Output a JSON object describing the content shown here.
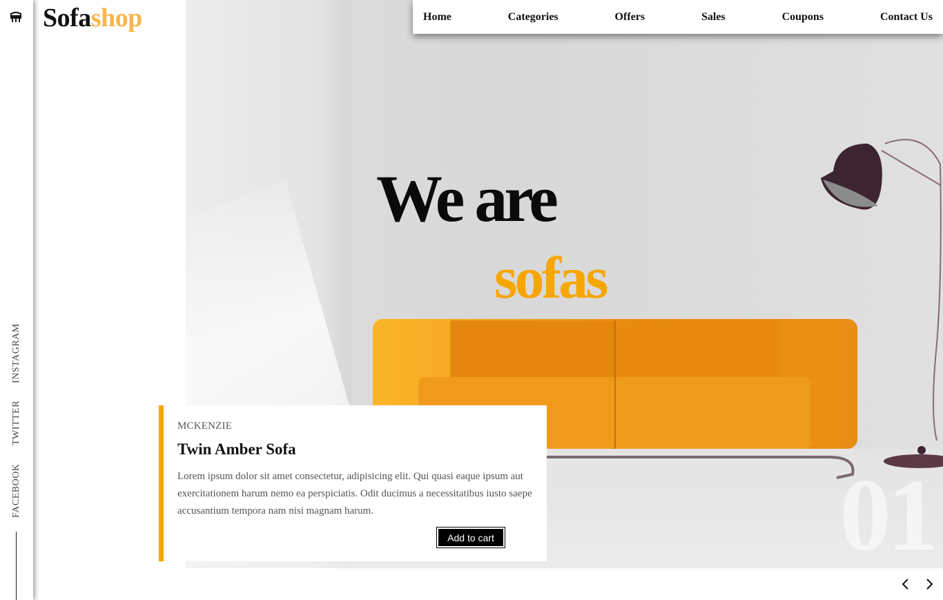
{
  "logo": {
    "part1": "Sofa",
    "part2": "shop"
  },
  "rail": {
    "icon": "sofa-icon",
    "social": [
      "INSTAGRAM",
      "TWITTER",
      "FACEBOOK"
    ]
  },
  "nav": {
    "items": [
      "Home",
      "Categories",
      "Offers",
      "Sales",
      "Coupons",
      "Contact Us"
    ]
  },
  "hero": {
    "title_line1": "We are",
    "title_line2": "sofas",
    "slide_number": "01"
  },
  "product": {
    "brand": "MCKENZIE",
    "name": "Twin Amber Sofa",
    "description": "Lorem ipsum dolor sit amet consectetur, adipisicing elit. Qui quasi eaque ipsum aut exercitationem harum nemo ea perspiciatis. Odit ducimus a necessitatibus iusto saepe accusantium tempora nam nisi magnam harum.",
    "cta": "Add to cart"
  },
  "carousel": {
    "prev_icon": "chevron-left-icon",
    "next_icon": "chevron-right-icon"
  },
  "colors": {
    "accent": "#f7a600",
    "logo_accent": "#f9b54a",
    "sofa": "#f29a1a"
  }
}
